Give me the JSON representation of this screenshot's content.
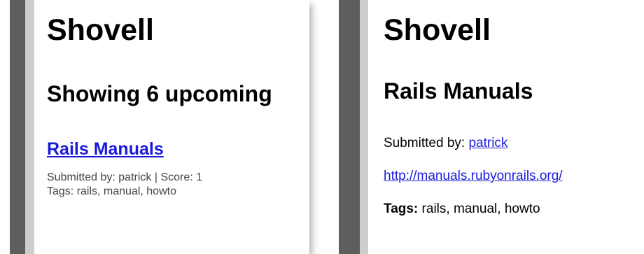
{
  "left": {
    "site_title": "Shovell",
    "heading": "Showing 6 upcoming",
    "item": {
      "title": "Rails Manuals",
      "submitted_line": "Submitted by: patrick | Score: 1",
      "tags_line": "Tags: rails, manual, howto"
    }
  },
  "right": {
    "site_title": "Shovell",
    "heading": "Rails Manuals",
    "submitted_label": "Submitted by:",
    "submitter": "patrick",
    "url": "http://manuals.rubyonrails.org/",
    "tags_label": "Tags:",
    "tags_value": "rails, manual, howto"
  },
  "colors": {
    "link": "#1a1adb",
    "sidebar_dark": "#5e5e5e",
    "sidebar_light": "#cdcdcd",
    "meta_text": "#444444"
  }
}
